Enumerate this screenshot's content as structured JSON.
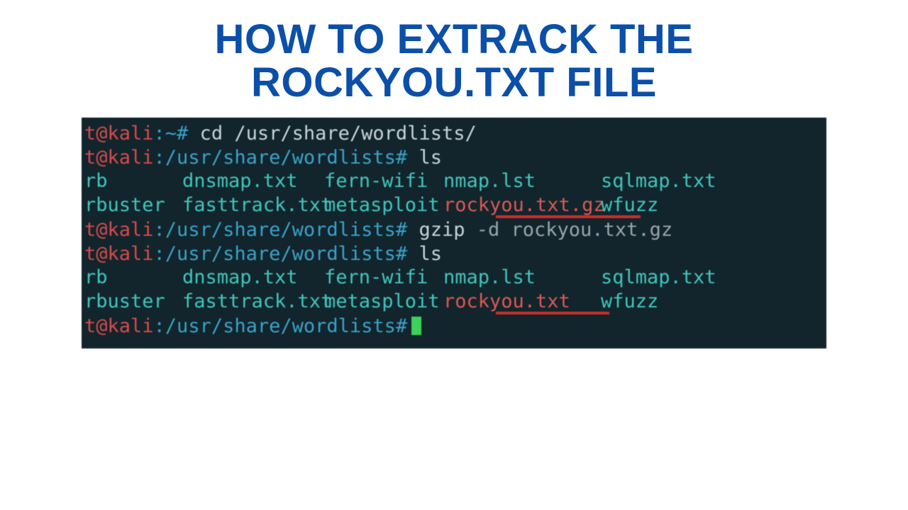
{
  "title_line1": "HOW TO EXTRACK THE",
  "title_line2": "ROCKYOU.TXT FILE",
  "prompt": {
    "user_at_host": "t@kali",
    "home_path": ":~#",
    "wl_path": ":/usr/share/wordlists#"
  },
  "commands": {
    "cd": "cd /usr/share/wordlists/",
    "ls": "ls",
    "gzip": "gzip",
    "gzip_flag": "-d",
    "gzip_arg": "rockyou.txt.gz"
  },
  "listing1": {
    "r1c1": "rb",
    "r1c2": "dnsmap.txt",
    "r1c3": "fern-wifi",
    "r1c4": "nmap.lst",
    "r1c5": "sqlmap.txt",
    "r2c1": "rbuster",
    "r2c2": "fasttrack.txt",
    "r2c3": "metasploit",
    "r2c4": "rockyou.txt.gz",
    "r2c5": "wfuzz"
  },
  "listing2": {
    "r1c1": "rb",
    "r1c2": "dnsmap.txt",
    "r1c3": "fern-wifi",
    "r1c4": "nmap.lst",
    "r1c5": "sqlmap.txt",
    "r2c1": "rbuster",
    "r2c2": "fasttrack.txt",
    "r2c3": "metasploit",
    "r2c4": "rockyou.txt",
    "r2c5": "wfuzz"
  }
}
